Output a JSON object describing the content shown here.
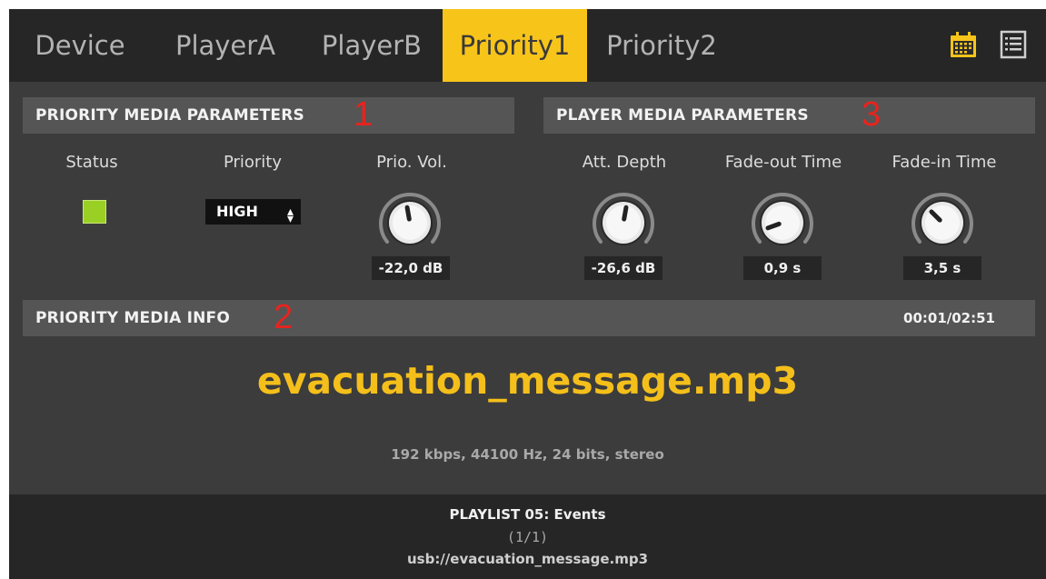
{
  "tabs": [
    {
      "label": "Device"
    },
    {
      "label": "PlayerA"
    },
    {
      "label": "PlayerB"
    },
    {
      "label": "Priority1"
    },
    {
      "label": "Priority2"
    }
  ],
  "active_tab": "Priority1",
  "icons": {
    "calendar": "calendar-icon",
    "list": "list-icon"
  },
  "accent_color": "#f7c41a",
  "priority_params": {
    "title": "PRIORITY MEDIA PARAMETERS",
    "marker": "1",
    "status_label": "Status",
    "status_color": "#9ad024",
    "priority_label": "Priority",
    "priority_value": "HIGH",
    "prio_vol_label": "Prio. Vol.",
    "prio_vol_value": "-22,0 dB"
  },
  "player_params": {
    "title": "PLAYER MEDIA PARAMETERS",
    "marker": "3",
    "att_depth_label": "Att. Depth",
    "att_depth_value": "-26,6 dB",
    "fade_out_label": "Fade-out Time",
    "fade_out_value": "0,9 s",
    "fade_in_label": "Fade-in Time",
    "fade_in_value": "3,5 s"
  },
  "info": {
    "title": "PRIORITY MEDIA INFO",
    "marker": "2",
    "time": "00:01/02:51",
    "filename": "evacuation_message.mp3",
    "details": "192 kbps, 44100 Hz, 24 bits, stereo"
  },
  "footer": {
    "playlist": "PLAYLIST 05: Events",
    "position": "(1/1)",
    "path": "usb://evacuation_message.mp3"
  }
}
